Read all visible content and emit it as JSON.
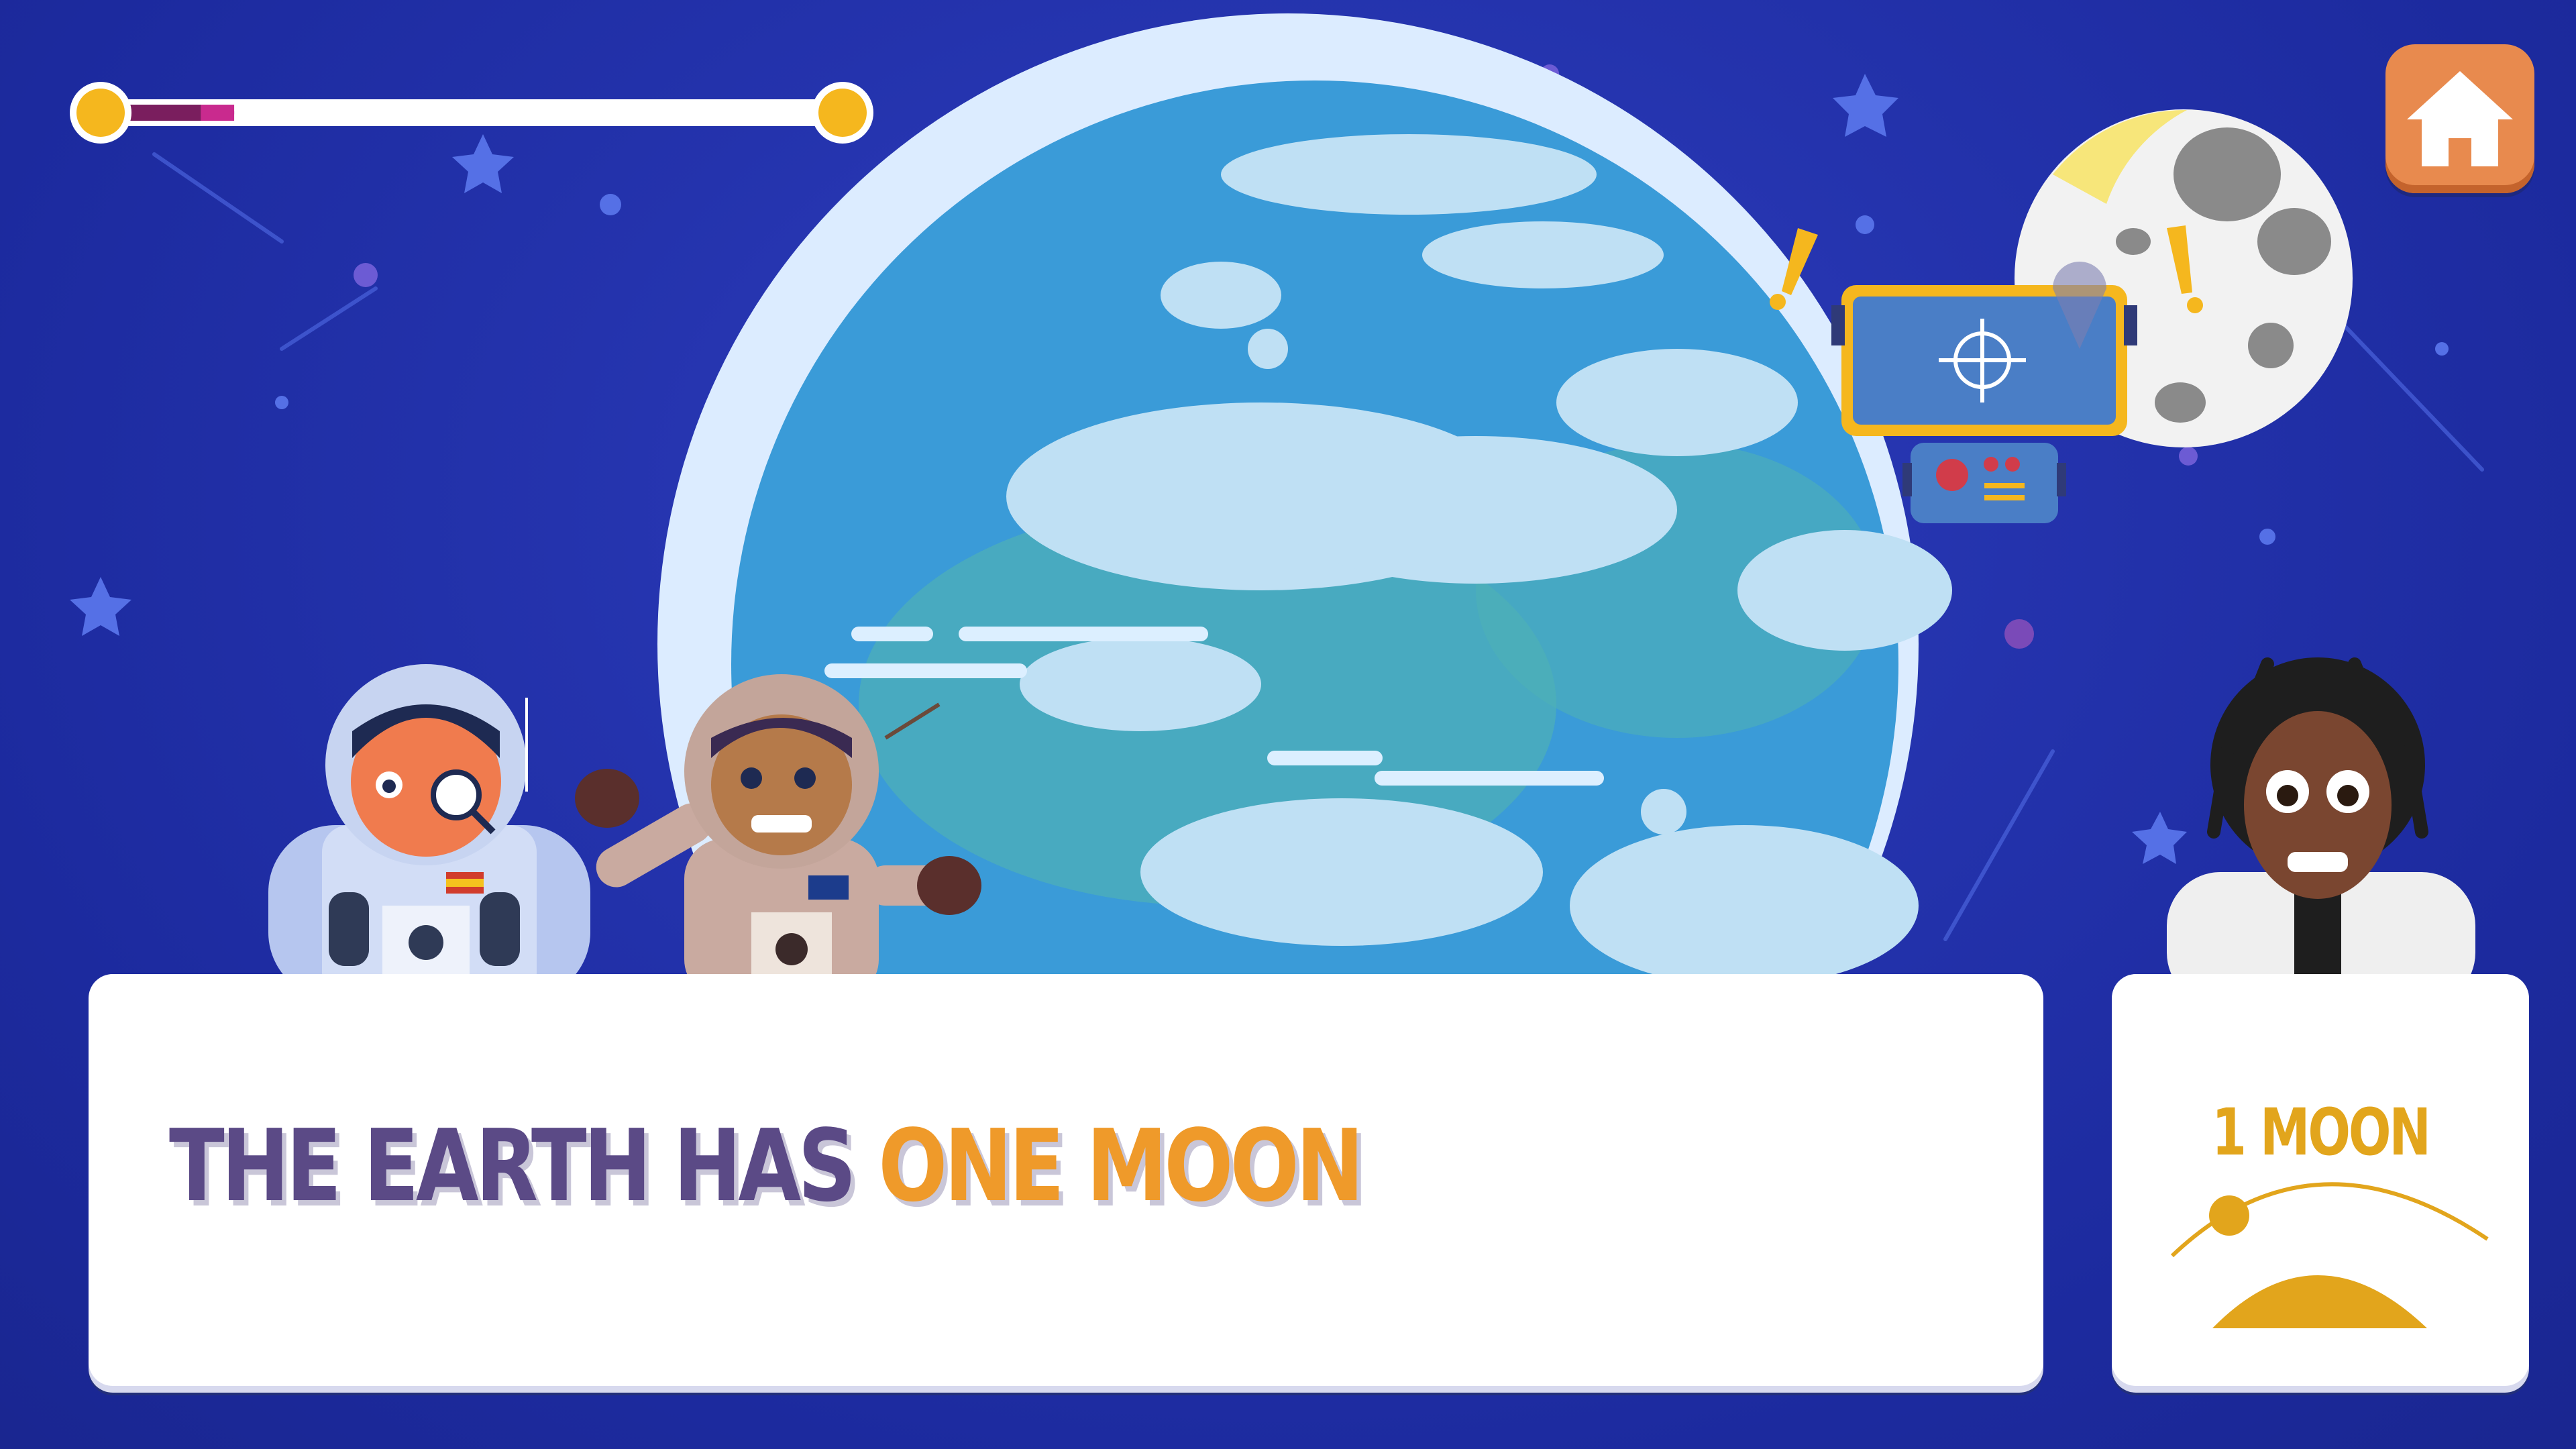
{
  "progress": {
    "fraction": 0.18
  },
  "dialog": {
    "text_plain": "THE EARTH HAS",
    "text_highlight": "ONE MOON"
  },
  "info_card": {
    "label": "1 MOON"
  },
  "home_button": {
    "icon": "house-icon"
  },
  "colors": {
    "background": "#2433ad",
    "text_plain": "#5b4a86",
    "text_highlight": "#ef9a2a",
    "accent_gold": "#f5b71e",
    "home_button": "#e88a4e",
    "progress_fill": "#7a1e5e"
  }
}
